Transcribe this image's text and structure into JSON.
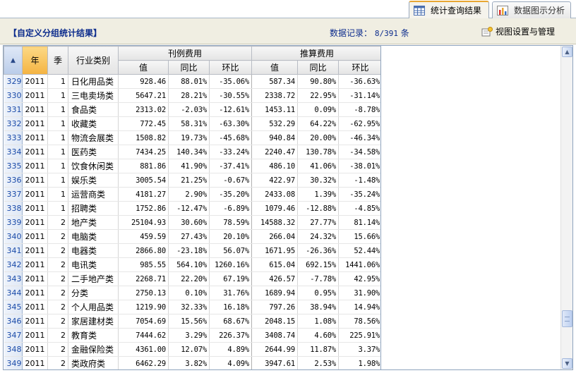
{
  "tabs": [
    {
      "label": "统计查询结果",
      "icon": "table-icon",
      "active": true
    },
    {
      "label": "数据图示分析",
      "icon": "bar-chart-icon",
      "active": false
    }
  ],
  "header": {
    "title": "【自定义分组统计结果】",
    "record_label": "数据记录：",
    "record_value": "8/391",
    "record_unit": "条",
    "view_settings": "视图设置与管理"
  },
  "table": {
    "corner": "▲",
    "headers": {
      "year": "年",
      "quarter": "季",
      "category": "行业类别",
      "group1": "刊例费用",
      "group2": "推算费用",
      "value": "值",
      "yoy": "同比",
      "mom": "环比"
    },
    "rows": [
      {
        "n": "329",
        "y": "2011",
        "q": "1",
        "c": "日化用品类",
        "v1": "928.46",
        "y1": "88.01%",
        "m1": "-35.06%",
        "v2": "587.34",
        "y2": "90.80%",
        "m2": "-36.63%"
      },
      {
        "n": "330",
        "y": "2011",
        "q": "1",
        "c": "三电卖场类",
        "v1": "5647.21",
        "y1": "28.21%",
        "m1": "-30.55%",
        "v2": "2338.72",
        "y2": "22.95%",
        "m2": "-31.14%"
      },
      {
        "n": "331",
        "y": "2011",
        "q": "1",
        "c": "食品类",
        "v1": "2313.02",
        "y1": "-2.03%",
        "m1": "-12.61%",
        "v2": "1453.11",
        "y2": "0.09%",
        "m2": "-8.78%"
      },
      {
        "n": "332",
        "y": "2011",
        "q": "1",
        "c": "收藏类",
        "v1": "772.45",
        "y1": "58.31%",
        "m1": "-63.30%",
        "v2": "532.29",
        "y2": "64.22%",
        "m2": "-62.95%"
      },
      {
        "n": "333",
        "y": "2011",
        "q": "1",
        "c": "物流会展类",
        "v1": "1508.82",
        "y1": "19.73%",
        "m1": "-45.68%",
        "v2": "940.84",
        "y2": "20.00%",
        "m2": "-46.34%"
      },
      {
        "n": "334",
        "y": "2011",
        "q": "1",
        "c": "医药类",
        "v1": "7434.25",
        "y1": "140.34%",
        "m1": "-33.24%",
        "v2": "2240.47",
        "y2": "130.78%",
        "m2": "-34.58%"
      },
      {
        "n": "335",
        "y": "2011",
        "q": "1",
        "c": "饮食休闲类",
        "v1": "881.86",
        "y1": "41.90%",
        "m1": "-37.41%",
        "v2": "486.10",
        "y2": "41.06%",
        "m2": "-38.01%"
      },
      {
        "n": "336",
        "y": "2011",
        "q": "1",
        "c": "娱乐类",
        "v1": "3005.54",
        "y1": "21.25%",
        "m1": "-0.67%",
        "v2": "422.97",
        "y2": "30.32%",
        "m2": "-1.48%"
      },
      {
        "n": "337",
        "y": "2011",
        "q": "1",
        "c": "运营商类",
        "v1": "4181.27",
        "y1": "2.90%",
        "m1": "-35.20%",
        "v2": "2433.08",
        "y2": "1.39%",
        "m2": "-35.24%"
      },
      {
        "n": "338",
        "y": "2011",
        "q": "1",
        "c": "招聘类",
        "v1": "1752.86",
        "y1": "-12.47%",
        "m1": "-6.89%",
        "v2": "1079.46",
        "y2": "-12.88%",
        "m2": "-4.85%"
      },
      {
        "n": "339",
        "y": "2011",
        "q": "2",
        "c": "地产类",
        "v1": "25104.93",
        "y1": "30.60%",
        "m1": "78.59%",
        "v2": "14588.32",
        "y2": "27.77%",
        "m2": "81.14%"
      },
      {
        "n": "340",
        "y": "2011",
        "q": "2",
        "c": "电脑类",
        "v1": "459.59",
        "y1": "27.43%",
        "m1": "20.10%",
        "v2": "266.04",
        "y2": "24.32%",
        "m2": "15.66%"
      },
      {
        "n": "341",
        "y": "2011",
        "q": "2",
        "c": "电器类",
        "v1": "2866.80",
        "y1": "-23.18%",
        "m1": "56.07%",
        "v2": "1671.95",
        "y2": "-26.36%",
        "m2": "52.44%"
      },
      {
        "n": "342",
        "y": "2011",
        "q": "2",
        "c": "电讯类",
        "v1": "985.55",
        "y1": "564.10%",
        "m1": "1260.16%",
        "v2": "615.04",
        "y2": "692.15%",
        "m2": "1441.06%"
      },
      {
        "n": "343",
        "y": "2011",
        "q": "2",
        "c": "二手地产类",
        "v1": "2268.71",
        "y1": "22.20%",
        "m1": "67.19%",
        "v2": "426.57",
        "y2": "-7.78%",
        "m2": "42.95%"
      },
      {
        "n": "344",
        "y": "2011",
        "q": "2",
        "c": "分类",
        "v1": "2750.13",
        "y1": "0.10%",
        "m1": "31.76%",
        "v2": "1689.94",
        "y2": "0.95%",
        "m2": "31.90%"
      },
      {
        "n": "345",
        "y": "2011",
        "q": "2",
        "c": "个人用品类",
        "v1": "1219.90",
        "y1": "32.33%",
        "m1": "16.18%",
        "v2": "797.26",
        "y2": "38.94%",
        "m2": "14.94%"
      },
      {
        "n": "346",
        "y": "2011",
        "q": "2",
        "c": "家居建材类",
        "v1": "7054.69",
        "y1": "15.56%",
        "m1": "68.67%",
        "v2": "2048.15",
        "y2": "1.08%",
        "m2": "78.56%"
      },
      {
        "n": "347",
        "y": "2011",
        "q": "2",
        "c": "教育类",
        "v1": "7444.62",
        "y1": "3.29%",
        "m1": "226.37%",
        "v2": "3408.74",
        "y2": "4.60%",
        "m2": "225.91%"
      },
      {
        "n": "348",
        "y": "2011",
        "q": "2",
        "c": "金融保险类",
        "v1": "4361.00",
        "y1": "12.07%",
        "m1": "4.89%",
        "v2": "2644.99",
        "y2": "11.87%",
        "m2": "3.37%"
      },
      {
        "n": "349",
        "y": "2011",
        "q": "2",
        "c": "类政府类",
        "v1": "6462.29",
        "y1": "3.82%",
        "m1": "4.09%",
        "v2": "3947.61",
        "y2": "2.53%",
        "m2": "1.98%"
      }
    ]
  },
  "scrollbar": {
    "up": "▲",
    "down": "▼",
    "position": 0.85
  }
}
